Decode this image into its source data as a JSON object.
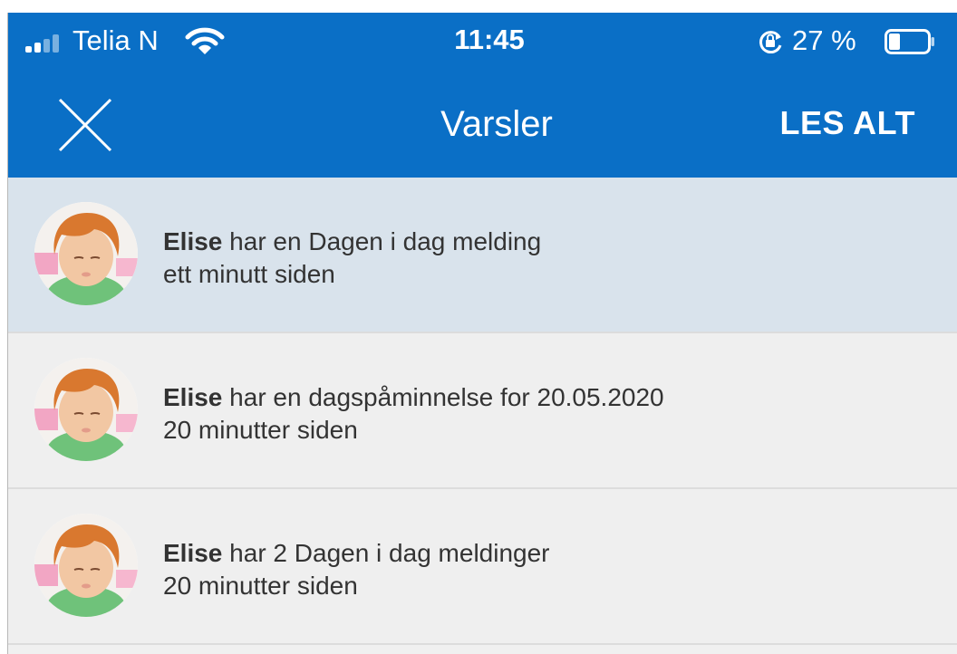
{
  "status_bar": {
    "carrier": "Telia N",
    "time": "11:45",
    "battery_percent": "27 %",
    "icons": [
      "signal-icon",
      "wifi-icon",
      "rotation-lock-icon",
      "battery-icon"
    ]
  },
  "header": {
    "title": "Varsler",
    "close_icon": "close-icon",
    "read_all_label": "LES ALT",
    "background": "#0a6fc6"
  },
  "notifications": [
    {
      "name": "Elise",
      "message": " har en Dagen i dag melding",
      "time": "ett minutt siden",
      "unread": true
    },
    {
      "name": "Elise",
      "message": " har en dagspåminnelse for 20.05.2020",
      "time": "20 minutter siden",
      "unread": false
    },
    {
      "name": "Elise",
      "message": " har 2 Dagen i dag meldinger",
      "time": "20 minutter siden",
      "unread": false
    }
  ],
  "colors": {
    "accent": "#0a6fc6",
    "unread_background": "#d9e3ec",
    "read_background": "#efefef"
  }
}
